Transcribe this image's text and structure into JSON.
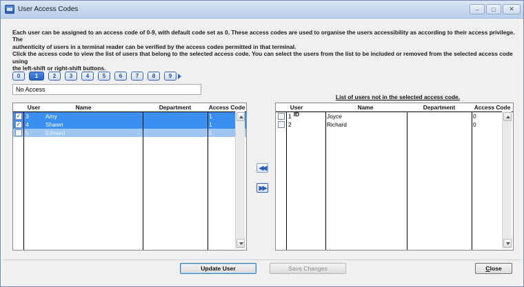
{
  "window": {
    "title": "User Access Codes"
  },
  "description": [
    "Each user can be assigned to an access code of 0-9, with default code set as 0. These access codes are used to organise the users accessibility as according to their access privilege. The",
    "authenticity of users in a terminal reader can be verified by the access codes permitted in that terminal.",
    "Click the access code to view the list of users that belong to the selected access code. You can select the users from the list to be included or removed from the selected access code using",
    "the left-shift or right-shift buttons."
  ],
  "access_codes": [
    "0",
    "1",
    "2",
    "3",
    "4",
    "5",
    "6",
    "7",
    "8",
    "9"
  ],
  "selected_code": "1",
  "selected_code_name": "No Access",
  "right_caption": "List of users not in the selected access code.",
  "left_grid": {
    "columns": [
      "User ID",
      "Name",
      "Department",
      "Access Code"
    ],
    "rows": [
      {
        "checked": true,
        "user_id": "3",
        "name": "Amy",
        "department": "",
        "access_code": "1"
      },
      {
        "checked": true,
        "user_id": "4",
        "name": "Shawn",
        "department": "",
        "access_code": "1"
      },
      {
        "checked": false,
        "user_id": "5",
        "name": "Edward",
        "department": "",
        "access_code": "1"
      }
    ]
  },
  "right_grid": {
    "columns": [
      "User ID",
      "Name",
      "Department",
      "Access Code"
    ],
    "rows": [
      {
        "checked": false,
        "user_id": "1",
        "name": "Joyce",
        "department": "",
        "access_code": "0"
      },
      {
        "checked": false,
        "user_id": "2",
        "name": "Richard",
        "department": "",
        "access_code": "0"
      }
    ]
  },
  "buttons": {
    "shift_left": "◀◀",
    "shift_right": "▶▶",
    "update_user": "Update User",
    "save_changes": "Save Changes",
    "close_underlined": "C",
    "close_rest": "lose"
  },
  "colors": {
    "selection": "#3b8ff0",
    "accent": "#2a62c2"
  }
}
